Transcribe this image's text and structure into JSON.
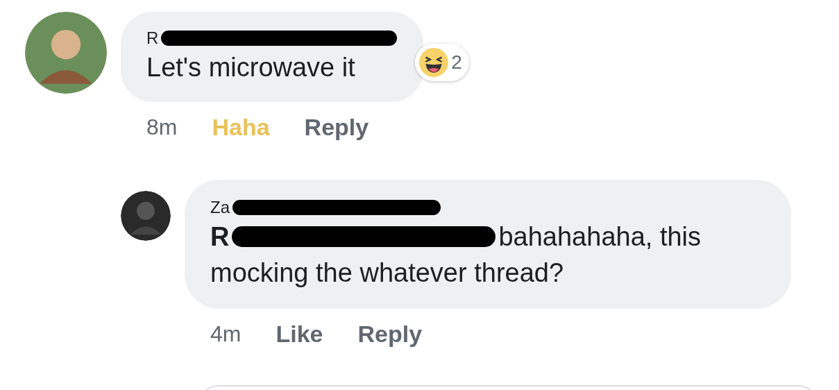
{
  "comments": [
    {
      "author": {
        "name": "R",
        "redacted": true
      },
      "text": "Let's microwave it",
      "reaction": {
        "count": "2"
      },
      "time": "8m",
      "like_label": "Haha",
      "liked": true,
      "reply_label": "Reply",
      "is_reply": false
    },
    {
      "author": {
        "name": "Za",
        "redacted": true
      },
      "mention": {
        "name": "R",
        "redacted": true
      },
      "text": "bahahahaha, this mocking the whatever thread?",
      "time": "4m",
      "like_label": "Like",
      "liked": false,
      "reply_label": "Reply",
      "is_reply": true
    }
  ]
}
